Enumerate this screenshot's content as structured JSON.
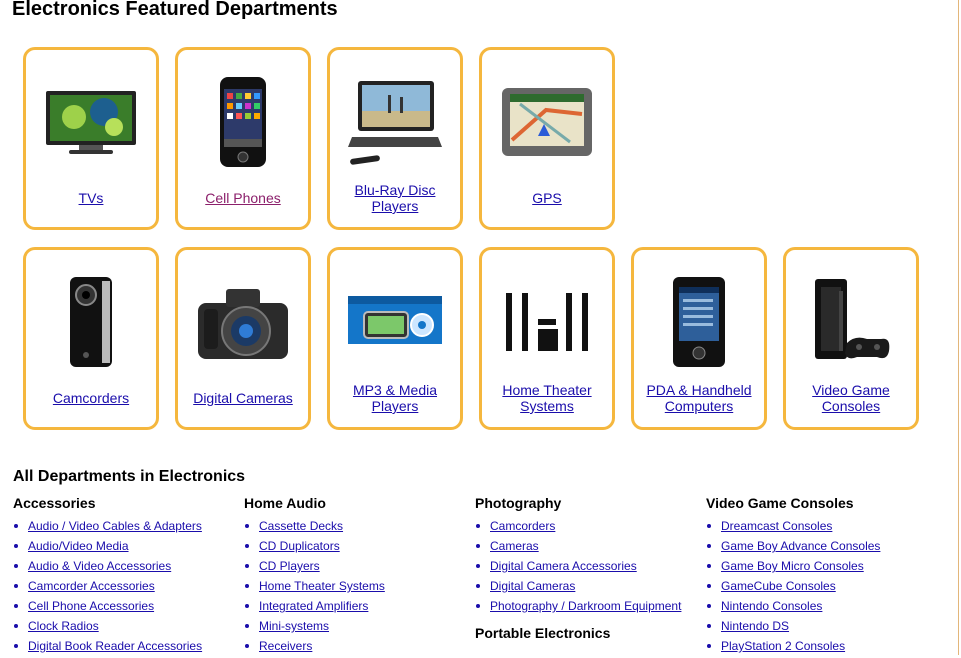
{
  "featured": {
    "title": "Electronics Featured Departments",
    "tiles_row1": [
      {
        "label": "TVs",
        "icon": "tv-icon"
      },
      {
        "label": "Cell Phones",
        "icon": "cell-phone-icon",
        "visited": true
      },
      {
        "label": "Blu-Ray Disc Players",
        "icon": "blu-ray-player-icon"
      },
      {
        "label": "GPS",
        "icon": "gps-icon"
      }
    ],
    "tiles_row2": [
      {
        "label": "Camcorders",
        "icon": "camcorder-icon"
      },
      {
        "label": "Digital Cameras",
        "icon": "digital-camera-icon"
      },
      {
        "label": "MP3 & Media Players",
        "icon": "mp3-player-icon"
      },
      {
        "label": "Home Theater Systems",
        "icon": "home-theater-icon"
      },
      {
        "label": "PDA & Handheld Computers",
        "icon": "pda-icon"
      },
      {
        "label": "Video Game Consoles",
        "icon": "game-console-icon"
      }
    ]
  },
  "all_departments": {
    "title": "All Departments in Electronics",
    "columns": [
      {
        "heading": "Accessories",
        "items": [
          "Audio / Video Cables & Adapters",
          "Audio/Video Media",
          "Audio & Video Accessories",
          "Camcorder Accessories",
          "Cell Phone Accessories",
          "Clock Radios",
          "Digital Book Reader Accessories"
        ]
      },
      {
        "heading": "Home Audio",
        "items": [
          "Cassette Decks",
          "CD Duplicators",
          "CD Players",
          "Home Theater Systems",
          "Integrated Amplifiers",
          "Mini-systems",
          "Receivers"
        ]
      },
      {
        "heading": "Photography",
        "items": [
          "Camcorders",
          "Cameras",
          "Digital Camera Accessories",
          "Digital Cameras",
          "Photography / Darkroom Equipment"
        ],
        "subheading": "Portable Electronics"
      },
      {
        "heading": "Video Game Consoles",
        "items": [
          "Dreamcast Consoles",
          "Game Boy Advance Consoles",
          "Game Boy Micro Consoles",
          "GameCube Consoles",
          "Nintendo Consoles",
          "Nintendo DS",
          "PlayStation 2 Consoles"
        ]
      }
    ]
  },
  "colors": {
    "tile_border": "#f5b73e",
    "link": "#1a0dab",
    "visited_link": "#8b1f6b"
  }
}
